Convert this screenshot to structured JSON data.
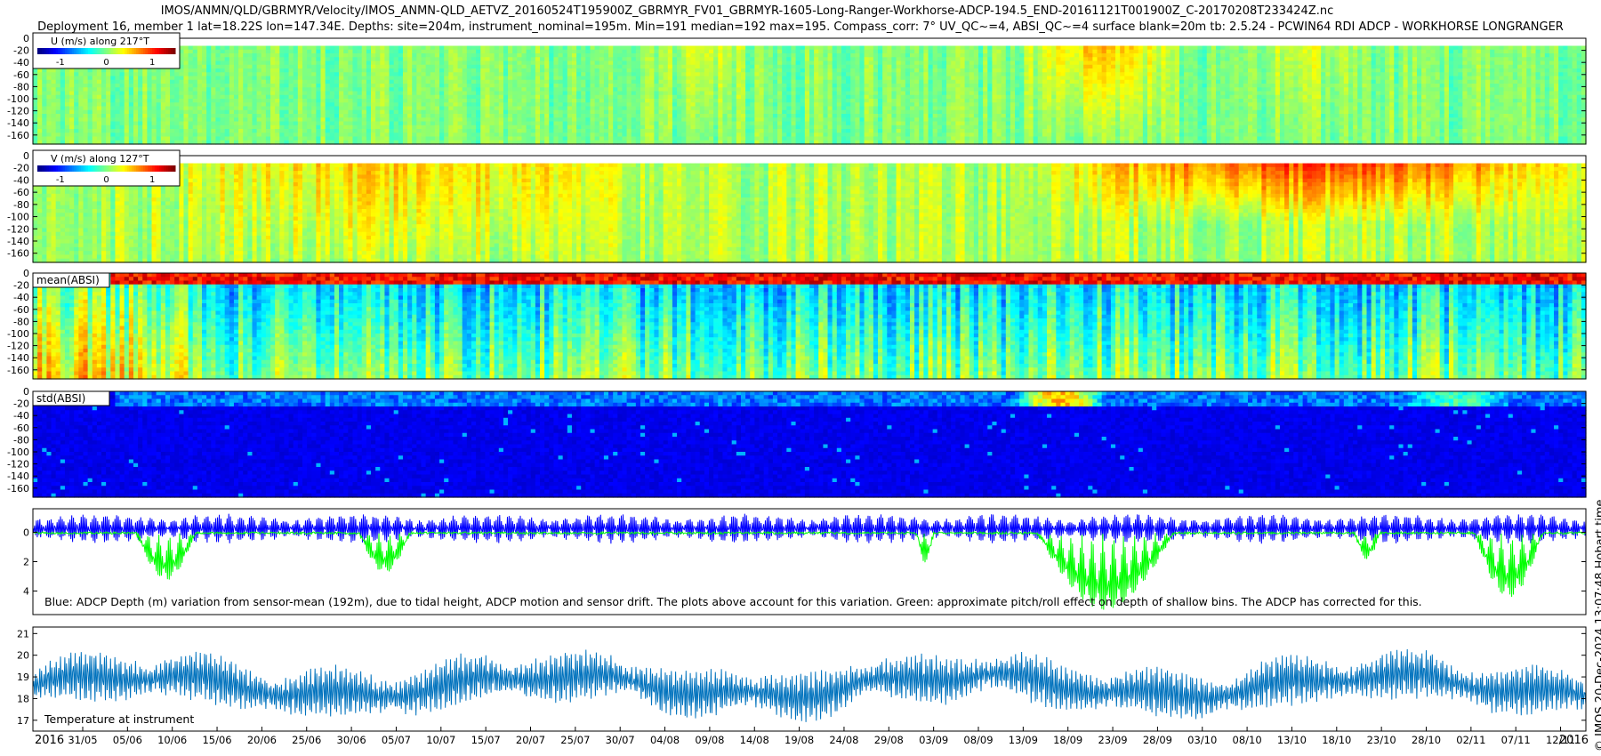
{
  "header": {
    "title_line1": "IMOS/ANMN/QLD/GBRMYR/Velocity/IMOS_ANMN-QLD_AETVZ_20160524T195900Z_GBRMYR_FV01_GBRMYR-1605-Long-Ranger-Workhorse-ADCP-194.5_END-20161121T001900Z_C-20170208T233424Z.nc",
    "title_line2": "Deployment 16, member 1 lat=18.22S lon=147.34E. Depths: site=204m, instrument_nominal=195m. Min=191 median=192 max=195. Compass_corr: 7° UV_QC~=4, ABSI_QC~=4 surface blank=20m tb: 2.5.24 - PCWIN64 RDI ADCP - WORKHORSE LONGRANGER"
  },
  "side_credit": "© IMOS 20-Dec-2024 13:07:48 Hobart time",
  "colors": {
    "background": "#ffffff",
    "depth_series": "#0000ff",
    "pitch_roll_series": "#00ff00",
    "temperature_series": "#0072bd",
    "jet_low": "#00008f",
    "jet_mid": "#00cc33",
    "jet_high": "#800000"
  },
  "chart_data": [
    {
      "type": "heatmap",
      "id": "u-velocity",
      "colorbar_label": "U (m/s) along 217°T",
      "colorbar_ticks": [
        "-1",
        "0",
        "1"
      ],
      "colorbar_range": [
        -1.5,
        1.5
      ],
      "colormap": "jet",
      "y_ticks": [
        "0",
        "-20",
        "-40",
        "-60",
        "-80",
        "-100",
        "-120",
        "-140",
        "-160"
      ],
      "ylim": [
        -175,
        0
      ],
      "x_range": [
        "2016-05-24",
        "2016-11-21"
      ],
      "dominant_value": 0.0,
      "note": "mostly near 0 m/s with streaks of positive values in the upper water column late August and mid-October"
    },
    {
      "type": "heatmap",
      "id": "v-velocity",
      "colorbar_label": "V (m/s) along 127°T",
      "colorbar_ticks": [
        "-1",
        "0",
        "1"
      ],
      "colorbar_range": [
        -1.5,
        1.5
      ],
      "colormap": "jet",
      "y_ticks": [
        "0",
        "-20",
        "-40",
        "-60",
        "-80",
        "-100",
        "-120",
        "-140",
        "-160"
      ],
      "ylim": [
        -175,
        0
      ],
      "x_range": [
        "2016-05-24",
        "2016-11-21"
      ],
      "dominant_value": 0.2,
      "note": "positive (yellow/orange) in upper 60 m from mid-September to late November"
    },
    {
      "type": "heatmap",
      "id": "mean-absi",
      "label": "mean(ABSI)",
      "colormap": "jet",
      "y_ticks": [
        "0",
        "-20",
        "-40",
        "-60",
        "-80",
        "-100",
        "-120",
        "-140",
        "-160"
      ],
      "ylim": [
        -175,
        0
      ],
      "x_range": [
        "2016-05-24",
        "2016-11-21"
      ]
    },
    {
      "type": "heatmap",
      "id": "std-absi",
      "label": "std(ABSI)",
      "colormap": "jet",
      "y_ticks": [
        "0",
        "-20",
        "-40",
        "-60",
        "-80",
        "-100",
        "-120",
        "-140",
        "-160"
      ],
      "ylim": [
        -175,
        0
      ],
      "x_range": [
        "2016-05-24",
        "2016-11-21"
      ]
    },
    {
      "type": "line",
      "id": "adcp-depth",
      "caption": "Blue: ADCP Depth (m) variation from sensor-mean (192m), due to tidal height, ADCP motion and sensor drift. The plots above account for this variation. Green: approximate pitch/roll effect on depth of shallow bins. The ADCP has corrected for this.",
      "y_ticks": [
        "0",
        "2",
        "4"
      ],
      "ylim": [
        5.6,
        -1.6
      ],
      "y_reversed": true,
      "series": [
        {
          "id": "depth",
          "color": "#0000ff",
          "baseline": 0.0,
          "tidal_amplitude": 0.9
        },
        {
          "id": "pitch-roll",
          "color": "#00ff00",
          "baseline": 0.0,
          "episodes": [
            {
              "start": "2016-06-05",
              "end": "2016-06-12",
              "depth_max": 3.2
            },
            {
              "start": "2016-07-01",
              "end": "2016-07-07",
              "depth_max": 2.7
            },
            {
              "start": "2016-09-04",
              "end": "2016-09-06",
              "depth_max": 2.0
            },
            {
              "start": "2016-09-18",
              "end": "2016-10-04",
              "depth_max": 5.2
            },
            {
              "start": "2016-10-25",
              "end": "2016-10-28",
              "depth_max": 1.8
            },
            {
              "start": "2016-11-08",
              "end": "2016-11-16",
              "depth_max": 4.4
            }
          ]
        }
      ]
    },
    {
      "type": "line",
      "id": "temperature",
      "caption": "Temperature at instrument",
      "y_ticks": [
        "17",
        "18",
        "19",
        "20",
        "21"
      ],
      "ylim": [
        16.5,
        21.3
      ],
      "series": [
        {
          "id": "temperature",
          "color": "#0072bd",
          "mean": 18.6,
          "tidal_amplitude": 1.1
        }
      ]
    }
  ],
  "x_axis": {
    "start_label": "2016",
    "end_label": "2016",
    "tick_labels": [
      "31/05",
      "05/06",
      "10/06",
      "15/06",
      "20/06",
      "25/06",
      "30/06",
      "05/07",
      "10/07",
      "15/07",
      "20/07",
      "25/07",
      "30/07",
      "04/08",
      "09/08",
      "14/08",
      "19/08",
      "24/08",
      "29/08",
      "03/09",
      "08/09",
      "13/09",
      "18/09",
      "23/09",
      "28/09",
      "03/10",
      "08/10",
      "13/10",
      "18/10",
      "23/10",
      "28/10",
      "02/11",
      "07/11",
      "12/11"
    ],
    "start_date": "2016-05-24",
    "end_date": "2016-11-21"
  }
}
